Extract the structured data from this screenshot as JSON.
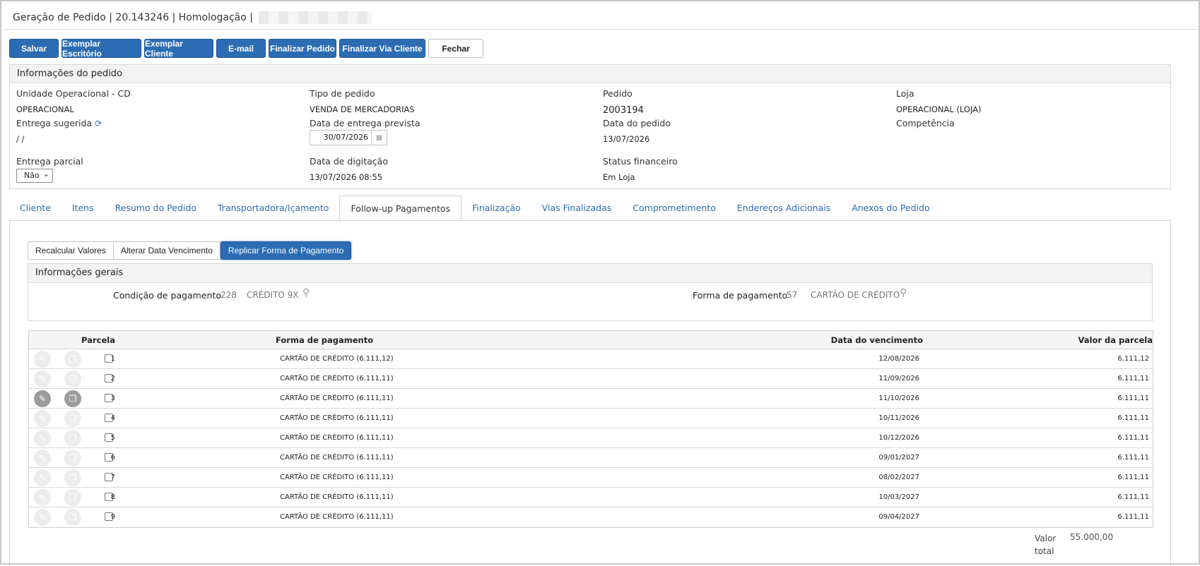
{
  "window": {
    "title": "Geração de Pedido | 20.143246 | Homologação |"
  },
  "toolbar": {
    "buttons": [
      {
        "label": "Salvar",
        "style": "primary"
      },
      {
        "label": "Exemplar Escritório",
        "style": "primary"
      },
      {
        "label": "Exemplar Cliente",
        "style": "primary"
      },
      {
        "label": "E-mail",
        "style": "primary"
      },
      {
        "label": "Finalizar Pedido",
        "style": "primary"
      },
      {
        "label": "Finalizar Via Cliente",
        "style": "primary"
      },
      {
        "label": "Fechar",
        "style": "plain"
      }
    ]
  },
  "order_info": {
    "heading": "Informações do pedido",
    "unidade_label": "Unidade Operacional - CD",
    "unidade_value": "OPERACIONAL",
    "tipo_label": "Tipo de pedido",
    "tipo_value": "VENDA DE MERCADORIAS",
    "pedido_label": "Pedido",
    "pedido_value": "2003194",
    "loja_label": "Loja",
    "loja_value": "OPERACIONAL (LOJA)",
    "entrega_sugerida_label": "Entrega sugerida",
    "entrega_sugerida_value": "/ /",
    "data_entrega_label": "Data de entrega prevista",
    "data_entrega_value": "30/07/2026",
    "data_pedido_label": "Data do pedido",
    "data_pedido_value": "13/07/2026",
    "competencia_label": "Competência",
    "entrega_parcial_label": "Entrega parcial",
    "entrega_parcial_value": "Não",
    "data_digitacao_label": "Data de digitação",
    "data_digitacao_value": "13/07/2026 08:55",
    "status_financeiro_label": "Status financeiro",
    "status_financeiro_value": "Em Loja"
  },
  "tabs": [
    {
      "label": "Cliente",
      "active": false
    },
    {
      "label": "Itens",
      "active": false
    },
    {
      "label": "Resumo do Pedido",
      "active": false
    },
    {
      "label": "Transportadora/Içamento",
      "active": false
    },
    {
      "label": "Follow-up Pagamentos",
      "active": true
    },
    {
      "label": "Finalização",
      "active": false
    },
    {
      "label": "Vias Finalizadas",
      "active": false
    },
    {
      "label": "Comprometimento",
      "active": false
    },
    {
      "label": "Endereços Adicionais",
      "active": false
    },
    {
      "label": "Anexos do Pedido",
      "active": false
    }
  ],
  "subtoolbar": {
    "recalcular": "Recalcular Valores",
    "alterar": "Alterar Data Vencimento",
    "replicar": "Replicar Forma de Pagamento"
  },
  "general": {
    "heading": "Informações gerais",
    "condicao_label": "Condição de pagamento",
    "condicao_code": "228",
    "condicao_desc": "CRÉDITO 9X",
    "forma_label": "Forma de pagamento",
    "forma_code": "57",
    "forma_desc": "CARTÃO DE CRÉDITO"
  },
  "grid": {
    "headers": {
      "parcela": "Parcela",
      "forma": "Forma de pagamento",
      "data": "Data do vencimento",
      "valor": "Valor da parcela"
    },
    "rows": [
      {
        "parcela": "1",
        "forma": "CARTÃO DE CRÉDITO (6.111,12)",
        "data": "12/08/2026",
        "valor": "6.111,12"
      },
      {
        "parcela": "2",
        "forma": "CARTÃO DE CRÉDITO (6.111,11)",
        "data": "11/09/2026",
        "valor": "6.111,11"
      },
      {
        "parcela": "3",
        "forma": "CARTÃO DE CRÉDITO (6.111,11)",
        "data": "11/10/2026",
        "valor": "6.111,11"
      },
      {
        "parcela": "4",
        "forma": "CARTÃO DE CRÉDITO (6.111,11)",
        "data": "10/11/2026",
        "valor": "6.111,11"
      },
      {
        "parcela": "5",
        "forma": "CARTÃO DE CRÉDITO (6.111,11)",
        "data": "10/12/2026",
        "valor": "6.111,11"
      },
      {
        "parcela": "6",
        "forma": "CARTÃO DE CRÉDITO (6.111,11)",
        "data": "09/01/2027",
        "valor": "6.111,11"
      },
      {
        "parcela": "7",
        "forma": "CARTÃO DE CRÉDITO (6.111,11)",
        "data": "08/02/2027",
        "valor": "6.111,11"
      },
      {
        "parcela": "8",
        "forma": "CARTÃO DE CRÉDITO (6.111,11)",
        "data": "10/03/2027",
        "valor": "6.111,11"
      },
      {
        "parcela": "9",
        "forma": "CARTÃO DE CRÉDITO (6.111,11)",
        "data": "09/04/2027",
        "valor": "6.111,11"
      }
    ],
    "highlighted_row": 3
  },
  "totals": {
    "label": "Valor total",
    "value": "55.000,00"
  },
  "icons": {
    "edit": "pencil-icon",
    "copy": "copy-icon",
    "search": "magnifier-icon",
    "refresh": "refresh-icon",
    "calendar": "calendar-icon"
  }
}
